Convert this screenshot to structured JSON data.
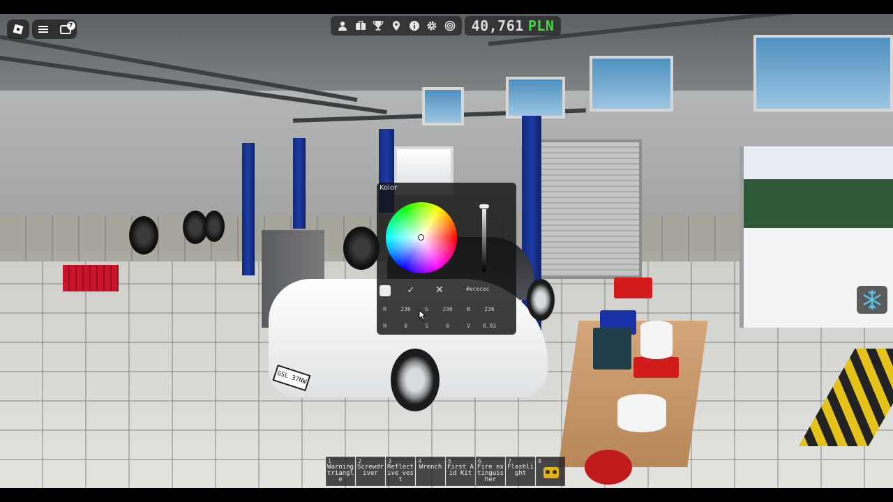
{
  "hud": {
    "money_amount": "40,761",
    "money_currency": "PLN",
    "chat_badge": "7",
    "icons": [
      "person-icon",
      "briefcase-icon",
      "trophy-icon",
      "location-pin-icon",
      "info-icon",
      "settings-icon",
      "target-icon"
    ]
  },
  "color_picker": {
    "title": "Kolor",
    "hex": "#ececec",
    "swatch_color": "#ececec",
    "r_label": "R",
    "r_value": "236",
    "g_label": "G",
    "g_value": "236",
    "b_label": "B",
    "b_value": "236",
    "h_label": "H",
    "h_value": "0",
    "s_label": "S",
    "s_value": "0",
    "v_label": "V",
    "v_value": "0.93"
  },
  "car": {
    "plate": "GSL 37NW"
  },
  "hotbar": [
    {
      "num": "1",
      "name": "Warning triangle"
    },
    {
      "num": "2",
      "name": "Screwdriver"
    },
    {
      "num": "3",
      "name": "Reflective vest"
    },
    {
      "num": "4",
      "name": "Wrench"
    },
    {
      "num": "5",
      "name": "First Aid Kit"
    },
    {
      "num": "6",
      "name": "Fire extinguisher"
    },
    {
      "num": "7",
      "name": "Flashlight"
    },
    {
      "num": "8",
      "name": ""
    }
  ]
}
